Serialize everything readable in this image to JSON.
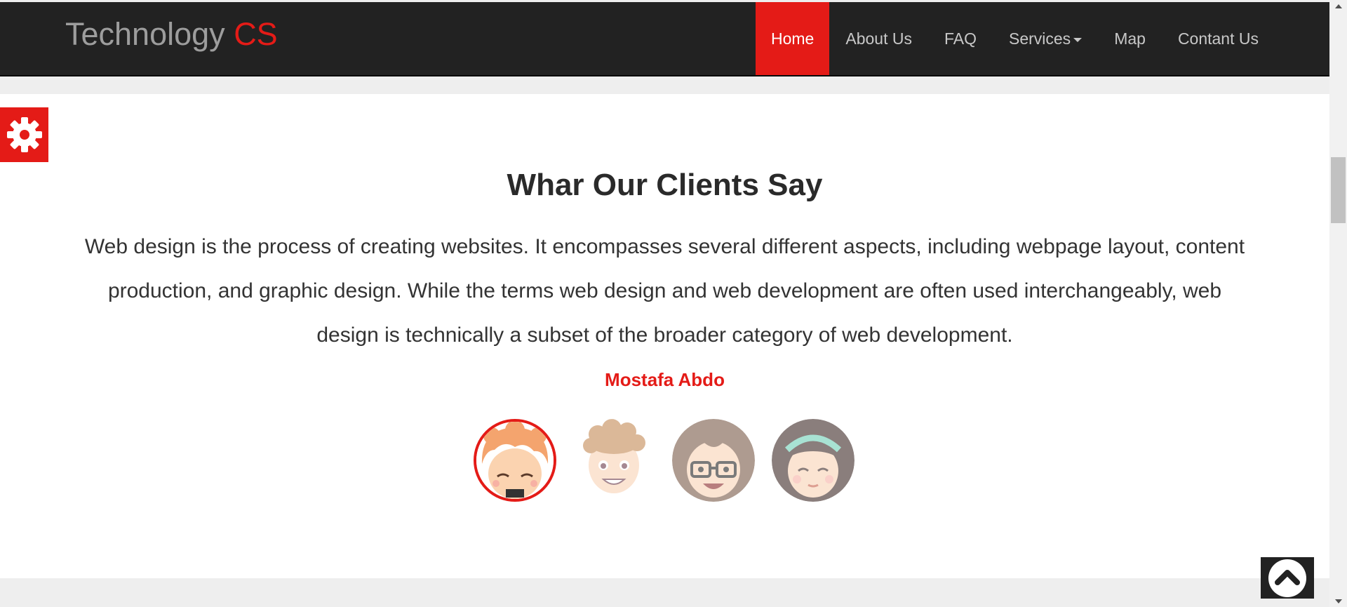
{
  "brand": {
    "name": "Technology",
    "accent": "CS"
  },
  "nav": {
    "items": [
      {
        "label": "Home"
      },
      {
        "label": "About Us"
      },
      {
        "label": "FAQ"
      },
      {
        "label": "Services"
      },
      {
        "label": "Map"
      },
      {
        "label": "Contant Us"
      }
    ]
  },
  "testimonials": {
    "title": "Whar Our Clients Say",
    "quote": "Web design is the process of creating websites. It encompasses several different aspects, including webpage layout, content production, and graphic design. While the terms web design and web development are often used interchangeably, web design is technically a subset of the broader category of web development.",
    "author": "Mostafa Abdo",
    "avatar_icons": [
      "avatar-orange-hair-icon",
      "avatar-curly-boy-icon",
      "avatar-glasses-icon",
      "avatar-headband-girl-icon"
    ]
  },
  "colors": {
    "accent": "#e41b17",
    "navbar": "#222222",
    "page_background": "#eeeeee"
  },
  "icons": {
    "settings": "gear-icon",
    "scroll_top": "chevron-up-icon"
  }
}
